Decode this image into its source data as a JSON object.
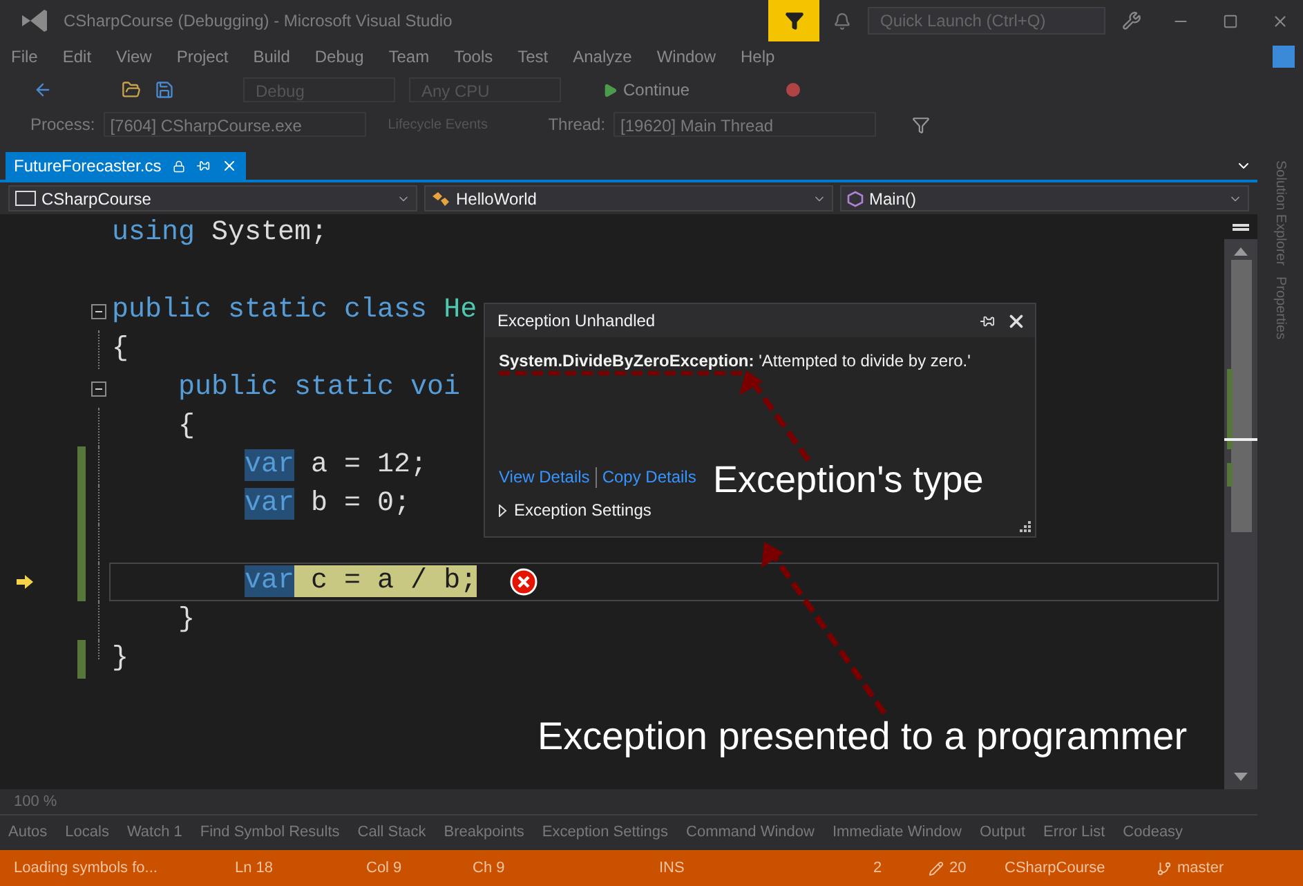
{
  "title_bar": {
    "title": "CSharpCourse (Debugging) - Microsoft Visual Studio",
    "quick_launch": {
      "placeholder": "Quick Launch (Ctrl+Q)"
    }
  },
  "menu": [
    "File",
    "Edit",
    "View",
    "Project",
    "Build",
    "Debug",
    "Team",
    "Tools",
    "Test",
    "Analyze",
    "Window",
    "Help"
  ],
  "toolbar": {
    "configuration": "Debug",
    "platform": "Any CPU",
    "continue": "Continue"
  },
  "debug_location": {
    "process_label": "Process:",
    "process": "[7604] CSharpCourse.exe",
    "lifecycle": "Lifecycle Events",
    "thread_label": "Thread:",
    "thread": "[19620] Main Thread"
  },
  "document_tabs": [
    {
      "label": "FutureForecaster.cs",
      "selected": true
    }
  ],
  "nav_bar": [
    {
      "kind": "project",
      "label": "CSharpCourse"
    },
    {
      "kind": "class",
      "label": "HelloWorld"
    },
    {
      "kind": "method",
      "label": "Main()"
    }
  ],
  "editor": {
    "lines": [
      {
        "kind": "code",
        "tokens": [
          {
            "text": "using",
            "kind": "keyword"
          },
          {
            "text": " System;",
            "kind": "plain"
          }
        ],
        "changed": false,
        "fold": false,
        "current": false,
        "error": false
      },
      {
        "kind": "blank"
      },
      {
        "kind": "code",
        "tokens": [
          {
            "text": "public static class",
            "kind": "keyword"
          },
          {
            "text": " He",
            "kind": "type"
          }
        ],
        "changed": false,
        "fold": true,
        "current": false,
        "error": false
      },
      {
        "kind": "code",
        "tokens": [
          {
            "text": "{",
            "kind": "plain"
          }
        ],
        "changed": false,
        "fold": false,
        "current": false,
        "error": false
      },
      {
        "kind": "code",
        "tokens": [
          {
            "text": "    public static voi",
            "kind": "keyword"
          }
        ],
        "changed": false,
        "fold": true,
        "current": false,
        "error": false
      },
      {
        "kind": "code",
        "tokens": [
          {
            "text": "    {",
            "kind": "plain"
          }
        ],
        "changed": false,
        "fold": false,
        "current": false,
        "error": false
      },
      {
        "kind": "code",
        "tokens": [
          {
            "text": "        var",
            "kind": "reference"
          },
          {
            "text": " a = 12;",
            "kind": "plain"
          }
        ],
        "changed": true,
        "fold": false,
        "current": false,
        "error": false
      },
      {
        "kind": "code",
        "tokens": [
          {
            "text": "        var",
            "kind": "reference"
          },
          {
            "text": " b = 0;",
            "kind": "plain"
          }
        ],
        "changed": true,
        "fold": false,
        "current": false,
        "error": false
      },
      {
        "kind": "blank",
        "changed": true
      },
      {
        "kind": "code",
        "tokens": [
          {
            "text": "        var",
            "kind": "reference"
          },
          {
            "text": " c = a / b;",
            "kind": "statement"
          }
        ],
        "changed": true,
        "fold": false,
        "current": true,
        "error": true
      },
      {
        "kind": "code",
        "tokens": [
          {
            "text": "    }",
            "kind": "plain"
          }
        ],
        "changed": false,
        "fold": false,
        "current": false,
        "error": false
      },
      {
        "kind": "code",
        "tokens": [
          {
            "text": "}",
            "kind": "plain"
          }
        ],
        "changed": true,
        "fold": false,
        "current": false,
        "error": false
      }
    ]
  },
  "exception_popup": {
    "title": "Exception Unhandled",
    "message": "**System.DivideByZeroException:** 'Attempted to divide by zero.'",
    "links": [
      "View Details",
      "Copy Details"
    ],
    "settings": {
      "label": "Exception Settings",
      "expanded": false
    }
  },
  "annotations": [
    {
      "kind": "type",
      "text": "Exception's type"
    },
    {
      "kind": "presented",
      "text": "Exception presented to a programmer"
    }
  ],
  "zoom": "100 %",
  "tool_tabs": [
    "Autos",
    "Locals",
    "Watch 1",
    "Find Symbol Results",
    "Call Stack",
    "Breakpoints",
    "Exception Settings",
    "Command Window",
    "Immediate Window",
    "Output",
    "Error List",
    "Codeasy"
  ],
  "status_bar": {
    "message": "Loading symbols fo...",
    "line": "Ln 18",
    "column": "Col 9",
    "char": "Ch 9",
    "mode": "INS",
    "branch_changes": "2",
    "edits": "20",
    "project": "CSharpCourse",
    "branch": "master"
  },
  "side_tabs": [
    "Solution Explorer",
    "Properties"
  ]
}
